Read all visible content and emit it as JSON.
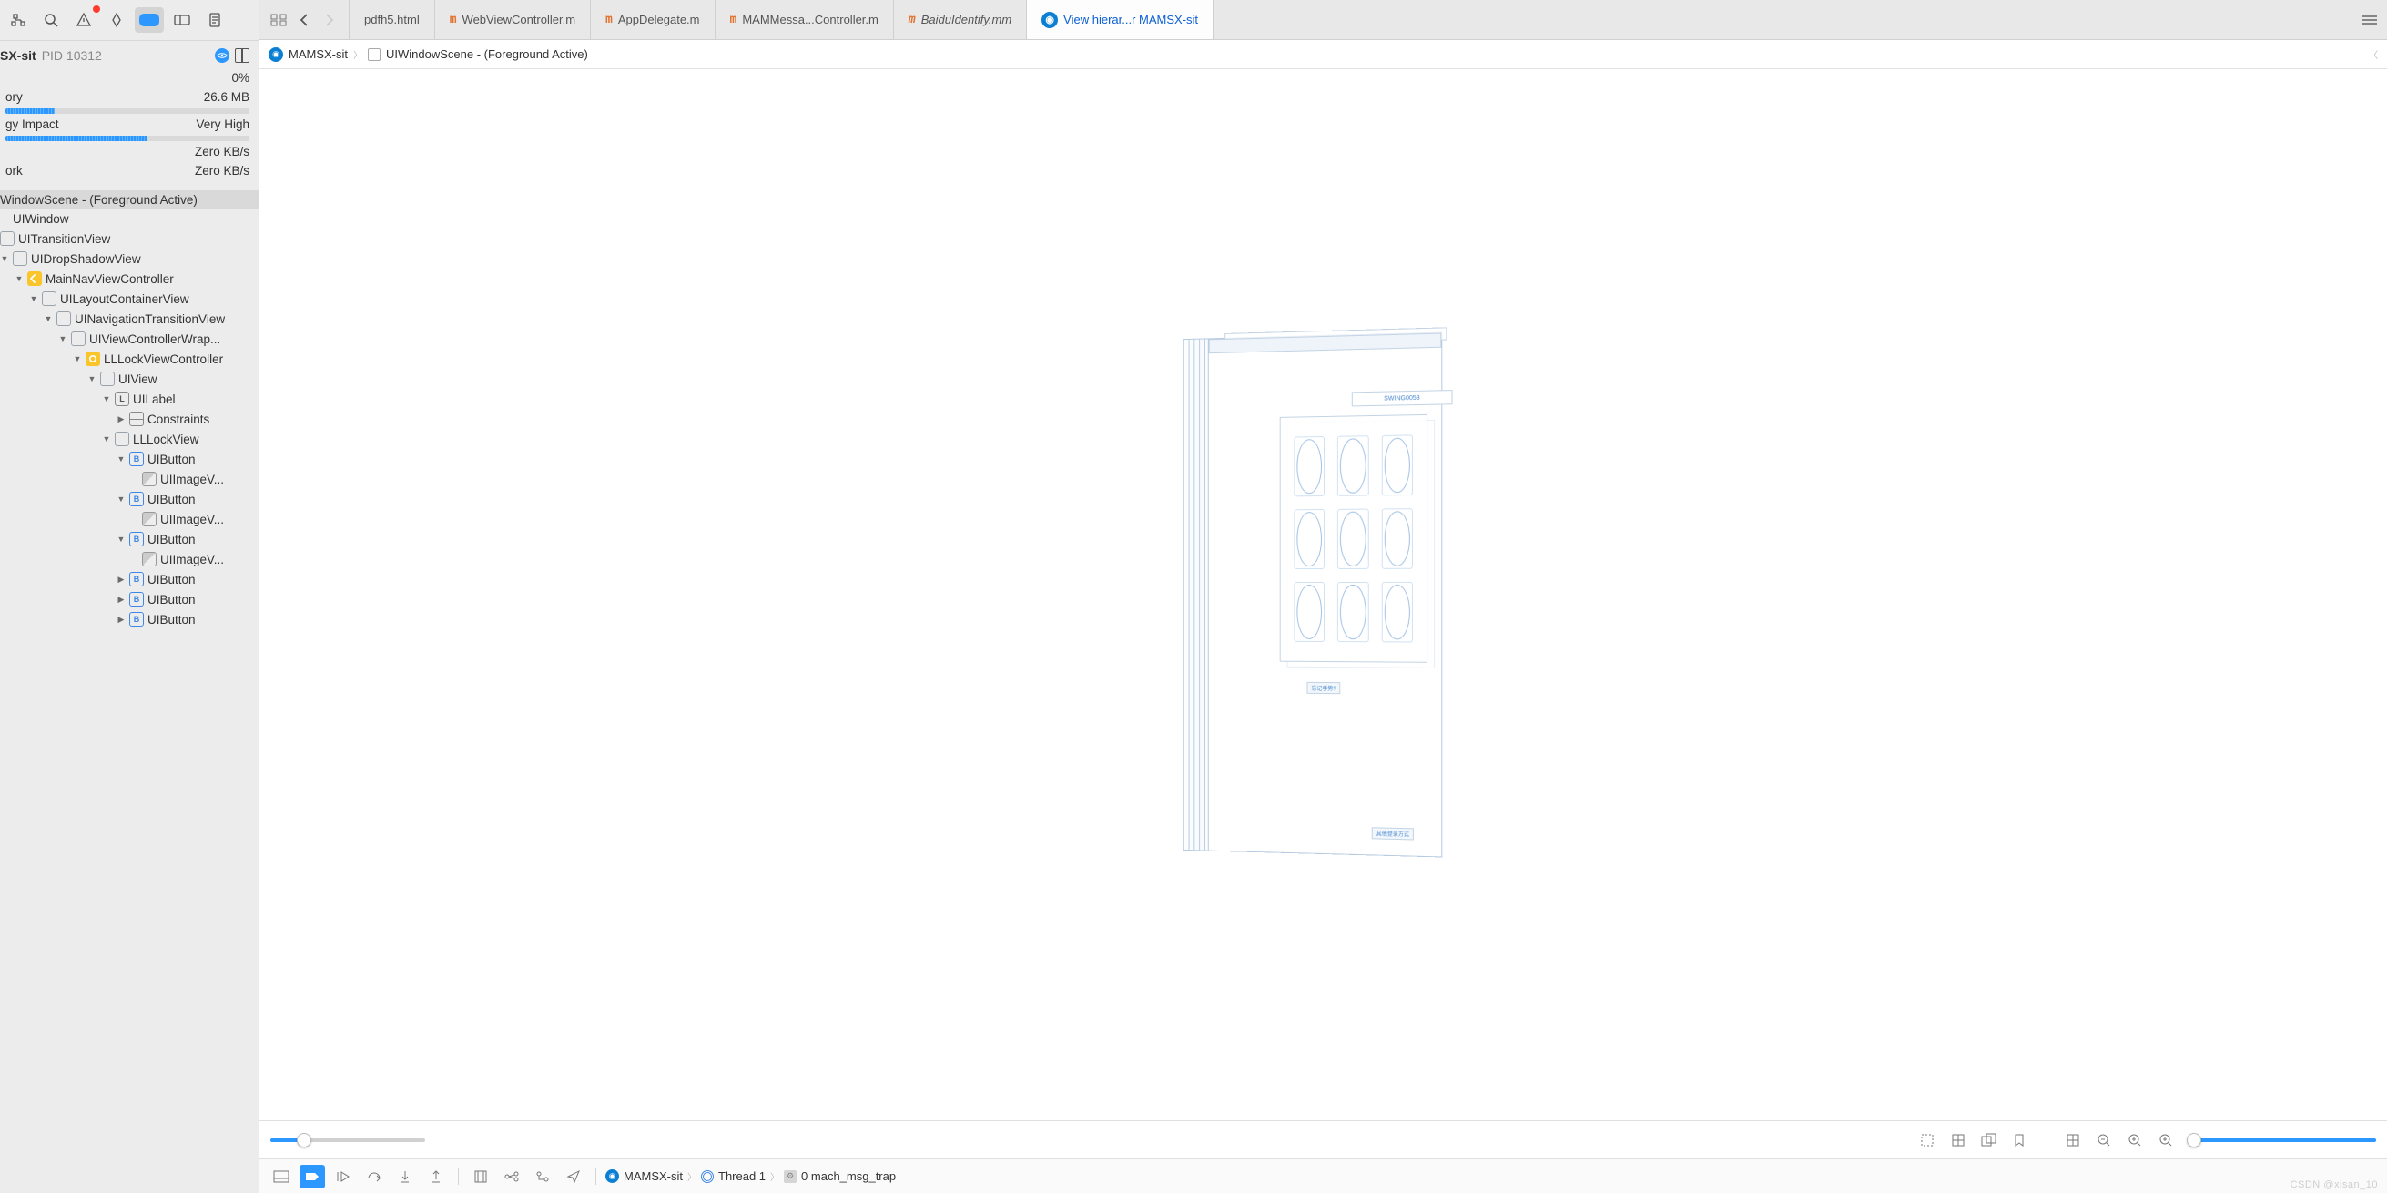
{
  "process": {
    "name": "SX-sit",
    "pid": "PID 10312"
  },
  "metrics": {
    "cpu": {
      "label": "",
      "value": "0%",
      "fill": 2
    },
    "memory": {
      "label": "ory",
      "value": "26.6 MB",
      "fill": 20
    },
    "energy": {
      "label": "gy Impact",
      "value": "Very High",
      "fill": 58
    },
    "diskR": {
      "label": "",
      "value": "Zero KB/s",
      "fill": 0
    },
    "network": {
      "label": "ork",
      "value": "Zero KB/s",
      "fill": 0
    }
  },
  "tree": {
    "scene": "WindowScene - (Foreground Active)",
    "nodes": [
      "UIWindow",
      "UITransitionView",
      "UIDropShadowView",
      "MainNavViewController",
      "UILayoutContainerView",
      "UINavigationTransitionView",
      "UIViewControllerWrap...",
      "LLLockViewController",
      "UIView",
      "UILabel",
      "Constraints",
      "LLLockView",
      "UIButton",
      "UIImageV...",
      "UIButton",
      "UIImageV...",
      "UIButton",
      "UIImageV...",
      "UIButton",
      "UIButton",
      "UIButton"
    ]
  },
  "tabs": {
    "t0": "pdfh5.html",
    "t1": "WebViewController.m",
    "t2": "AppDelegate.m",
    "t3": "MAMMessa...Controller.m",
    "t4": "BaiduIdentify.mm",
    "t5": "View hierar...r MAMSX-sit"
  },
  "breadcrumb": {
    "app": "MAMSX-sit",
    "scene": "UIWindowScene - (Foreground Active)"
  },
  "canvas": {
    "title": "SWING0053",
    "forgot": "忘记手势?",
    "other": "其他登录方式"
  },
  "debug": {
    "app": "MAMSX-sit",
    "thread": "Thread 1",
    "frame": "0 mach_msg_trap"
  },
  "watermark": "CSDN @xisan_10"
}
